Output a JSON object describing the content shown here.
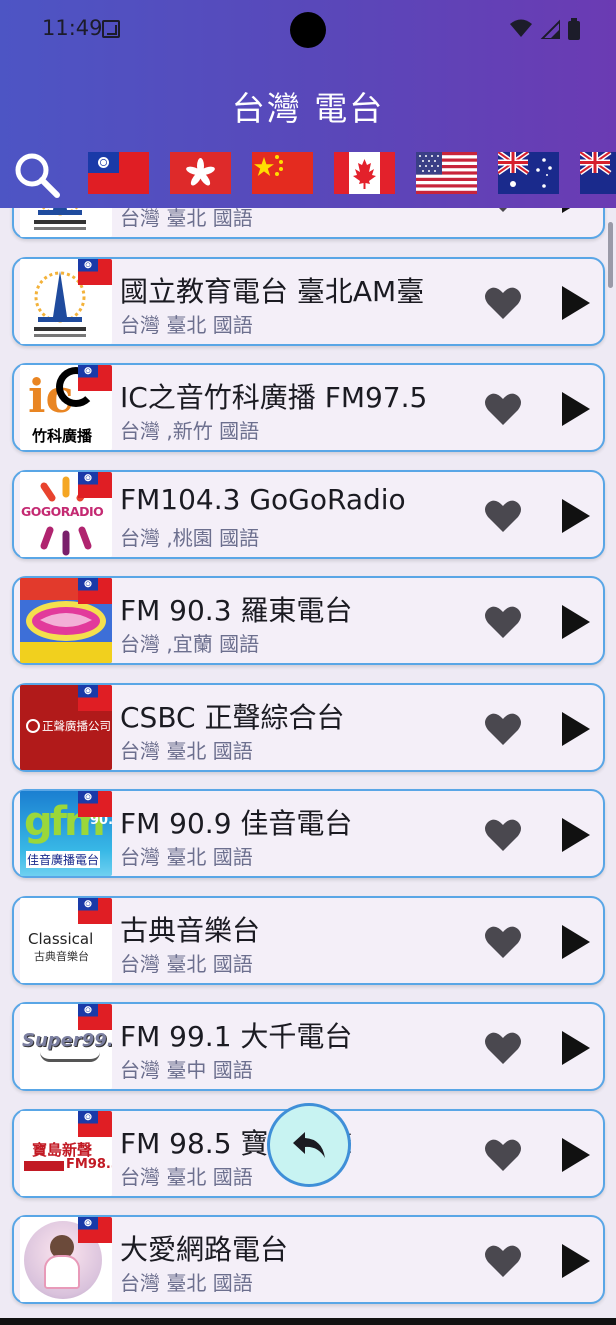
{
  "status_bar": {
    "time": "11:49"
  },
  "app": {
    "title": "台灣 電台"
  },
  "flags": [
    {
      "name": "taiwan-flag"
    },
    {
      "name": "hong-kong-flag"
    },
    {
      "name": "china-flag"
    },
    {
      "name": "canada-flag"
    },
    {
      "name": "usa-flag"
    },
    {
      "name": "australia-flag"
    },
    {
      "name": "new-zealand-flag"
    }
  ],
  "stations": [
    {
      "name": "",
      "subtitle": "台灣  臺北 國語",
      "logo": "edu",
      "partial": true
    },
    {
      "name": "國立教育電台 臺北AM臺",
      "subtitle": "台灣  臺北 國語",
      "logo": "edu"
    },
    {
      "name": "IC之音竹科廣播 FM97.5",
      "subtitle": "台灣  ,新竹 國語",
      "logo": "ic",
      "logo_text": "竹科廣播"
    },
    {
      "name": "FM104.3 GoGoRadio",
      "subtitle": "台灣  ,桃園 國語",
      "logo": "gogo",
      "logo_text": "GOGORADIO"
    },
    {
      "name": "FM 90.3 羅東電台",
      "subtitle": "台灣  ,宜蘭 國語",
      "logo": "love"
    },
    {
      "name": "CSBC 正聲綜合台",
      "subtitle": "台灣  臺北 國語",
      "logo": "csbc",
      "logo_text": "正聲廣播公司"
    },
    {
      "name": "FM 90.9 佳音電台",
      "subtitle": "台灣  臺北 國語",
      "logo": "gfm",
      "logo_text": "佳音廣播電台"
    },
    {
      "name": "古典音樂台",
      "subtitle": "台灣  臺北 國語",
      "logo": "classical",
      "logo_text": "Classical",
      "logo_text2": "古典音樂台"
    },
    {
      "name": "FM 99.1 大千電台",
      "subtitle": "台灣  臺中 國語",
      "logo": "super",
      "logo_text": "Super99.1"
    },
    {
      "name": "FM 98.5 寶島新聲",
      "subtitle": "台灣  臺北 國語",
      "logo": "baodao",
      "logo_text": "寶島新聲",
      "logo_text2": "FM98.5"
    },
    {
      "name": "大愛網路電台",
      "subtitle": "台灣  臺北 國語",
      "logo": "daai"
    }
  ],
  "colors": {
    "header_start": "#4d55c4",
    "header_end": "#6b3bb3",
    "card_border": "#59a6e6",
    "card_bg": "#f4eff8",
    "fab_bg": "#c8f3f2"
  }
}
